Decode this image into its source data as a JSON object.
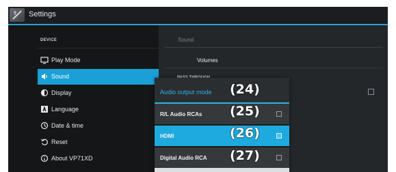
{
  "titlebar": {
    "title": "Settings",
    "icon": "settings-icon"
  },
  "sidebar": {
    "section_header": "DEVICE",
    "items": [
      {
        "label": "Play Mode",
        "icon": "monitor-icon",
        "active": false
      },
      {
        "label": "Sound",
        "icon": "speaker-icon",
        "active": true
      },
      {
        "label": "Display",
        "icon": "contrast-icon",
        "active": false
      },
      {
        "label": "Language",
        "icon": "language-icon",
        "active": false
      },
      {
        "label": "Date & time",
        "icon": "clock-icon",
        "active": false
      },
      {
        "label": "Reset",
        "icon": "reset-icon",
        "active": false
      },
      {
        "label": "About VP71XD",
        "icon": "info-icon",
        "active": false
      }
    ]
  },
  "content": {
    "title": "Sound",
    "volumes_label": "Volumes",
    "passthrough_header": "PASS THROUGH"
  },
  "dialog": {
    "title": "Audio output mode",
    "options": [
      {
        "label": "R/L Audio RCAs",
        "selected": false
      },
      {
        "label": "HDMI",
        "selected": true
      },
      {
        "label": "Digital Audio RCA",
        "selected": false
      }
    ]
  },
  "callouts": [
    "(24)",
    "(25)",
    "(26)",
    "(27)"
  ],
  "colors": {
    "accent": "#1aa0d6",
    "dialog_title": "#2fb1e4",
    "background": "#101214"
  }
}
